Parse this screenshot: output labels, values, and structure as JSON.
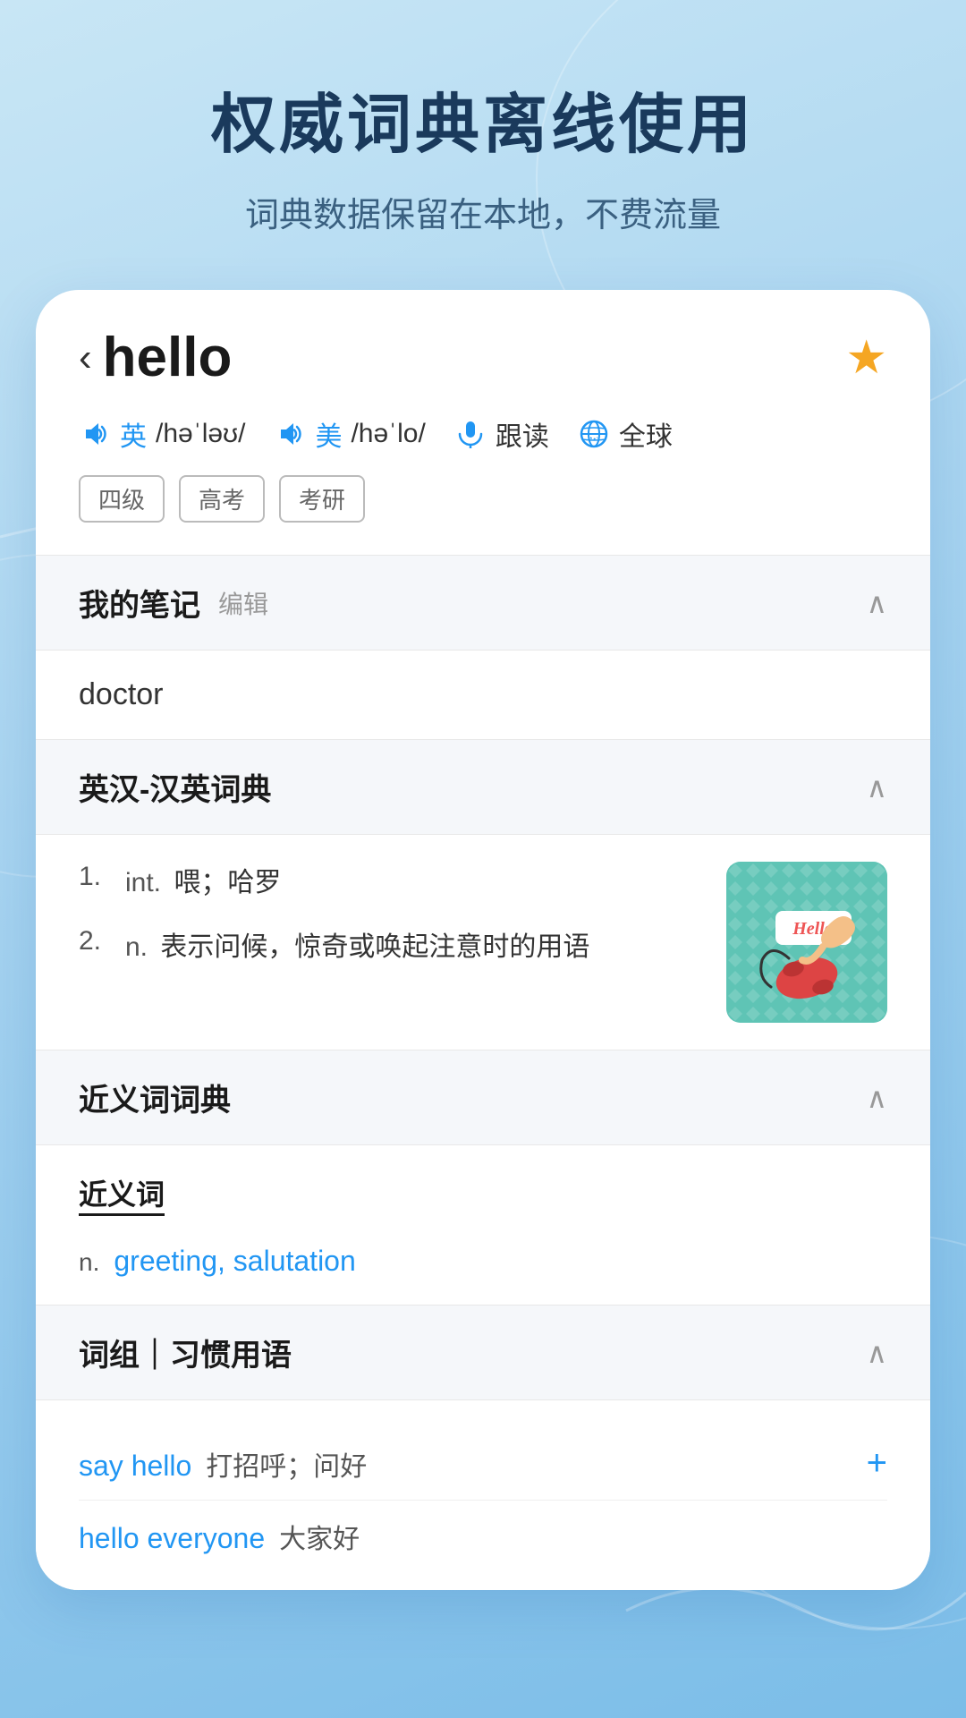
{
  "app": {
    "title": "权威词典离线使用",
    "subtitle": "词典数据保留在本地，不费流量"
  },
  "word": {
    "back_label": "‹",
    "word": "hello",
    "star": "★",
    "uk_label": "英",
    "uk_pron": "/həˈləʊ/",
    "us_label": "美",
    "us_pron": "/həˈlo/",
    "follow_label": "跟读",
    "global_label": "全球",
    "tags": [
      "四级",
      "高考",
      "考研"
    ]
  },
  "notes": {
    "section_title": "我的笔记",
    "edit_label": "编辑",
    "content": "doctor"
  },
  "dictionary": {
    "section_title": "英汉-汉英词典",
    "definitions": [
      {
        "num": "1.",
        "pos": "int.",
        "text": "喂；哈罗"
      },
      {
        "num": "2.",
        "pos": "n.",
        "text": "表示问候，惊奇或唤起注意时的用语"
      }
    ]
  },
  "synonyms": {
    "section_title": "近义词词典",
    "label": "近义词",
    "pos": "n.",
    "words": "greeting, salutation"
  },
  "phrases": {
    "section_title": "词组｜习惯用语",
    "items": [
      {
        "word": "say hello",
        "meaning": "打招呼；问好"
      },
      {
        "word": "hello everyone",
        "meaning": "大家好"
      }
    ]
  }
}
